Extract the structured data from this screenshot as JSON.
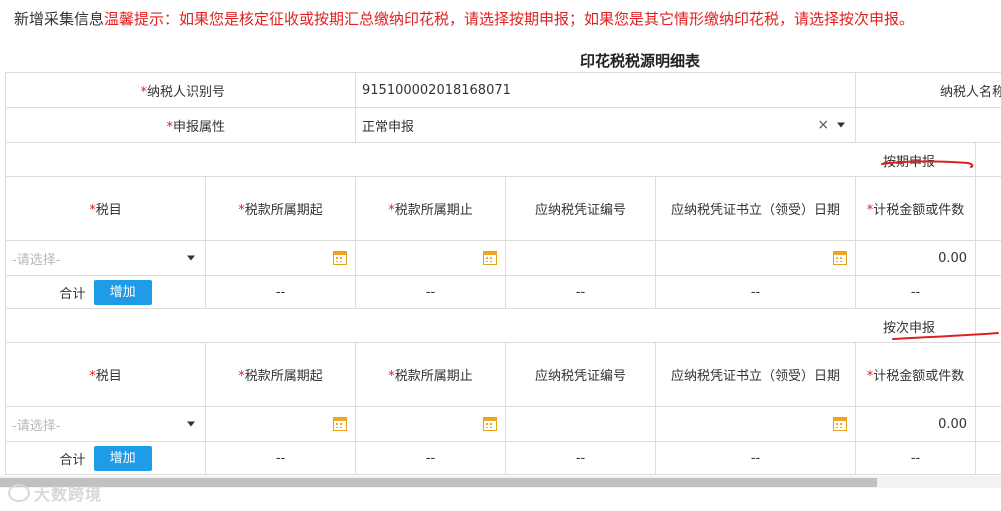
{
  "notice": {
    "prefix": "新增采集信息",
    "warning": "温馨提示：如果您是核定征收或按期汇总缴纳印花税，请选择按期申报；如果您是其它情形缴纳印花税，请选择按次申报。"
  },
  "form_title": "印花税税源明细表",
  "taxpayer": {
    "id_label": "纳税人识别号",
    "id_value": "915100002018168071",
    "name_label": "纳税人名称",
    "declare_attr_label": "申报属性",
    "declare_attr_value": "正常申报",
    "clear_symbol": "×"
  },
  "required_mark": "*",
  "sections": [
    {
      "title": "按期申报",
      "columns": [
        "税目",
        "税款所属期起",
        "税款所属期止",
        "应纳税凭证编号",
        "应纳税凭证书立（领受）日期",
        "计税金额或件数"
      ],
      "required": [
        true,
        true,
        true,
        false,
        false,
        true
      ],
      "row": {
        "item_placeholder": "-请选择-",
        "amount": "0.00"
      },
      "total": {
        "label": "合计",
        "add_label": "增加",
        "dash": "--"
      }
    },
    {
      "title": "按次申报",
      "columns": [
        "税目",
        "税款所属期起",
        "税款所属期止",
        "应纳税凭证编号",
        "应纳税凭证书立（领受）日期",
        "计税金额或件数"
      ],
      "required": [
        true,
        true,
        true,
        false,
        false,
        true
      ],
      "row": {
        "item_placeholder": "-请选择-",
        "amount": "0.00"
      },
      "total": {
        "label": "合计",
        "add_label": "增加",
        "dash": "--"
      }
    }
  ],
  "watermark": "大数跨境",
  "colors": {
    "warning": "#e02020",
    "button": "#1e9be9",
    "calendar": "#f0a820",
    "annotation": "#e02020"
  },
  "icons": [
    "calendar-icon",
    "chevron-down-icon",
    "clear-icon"
  ]
}
